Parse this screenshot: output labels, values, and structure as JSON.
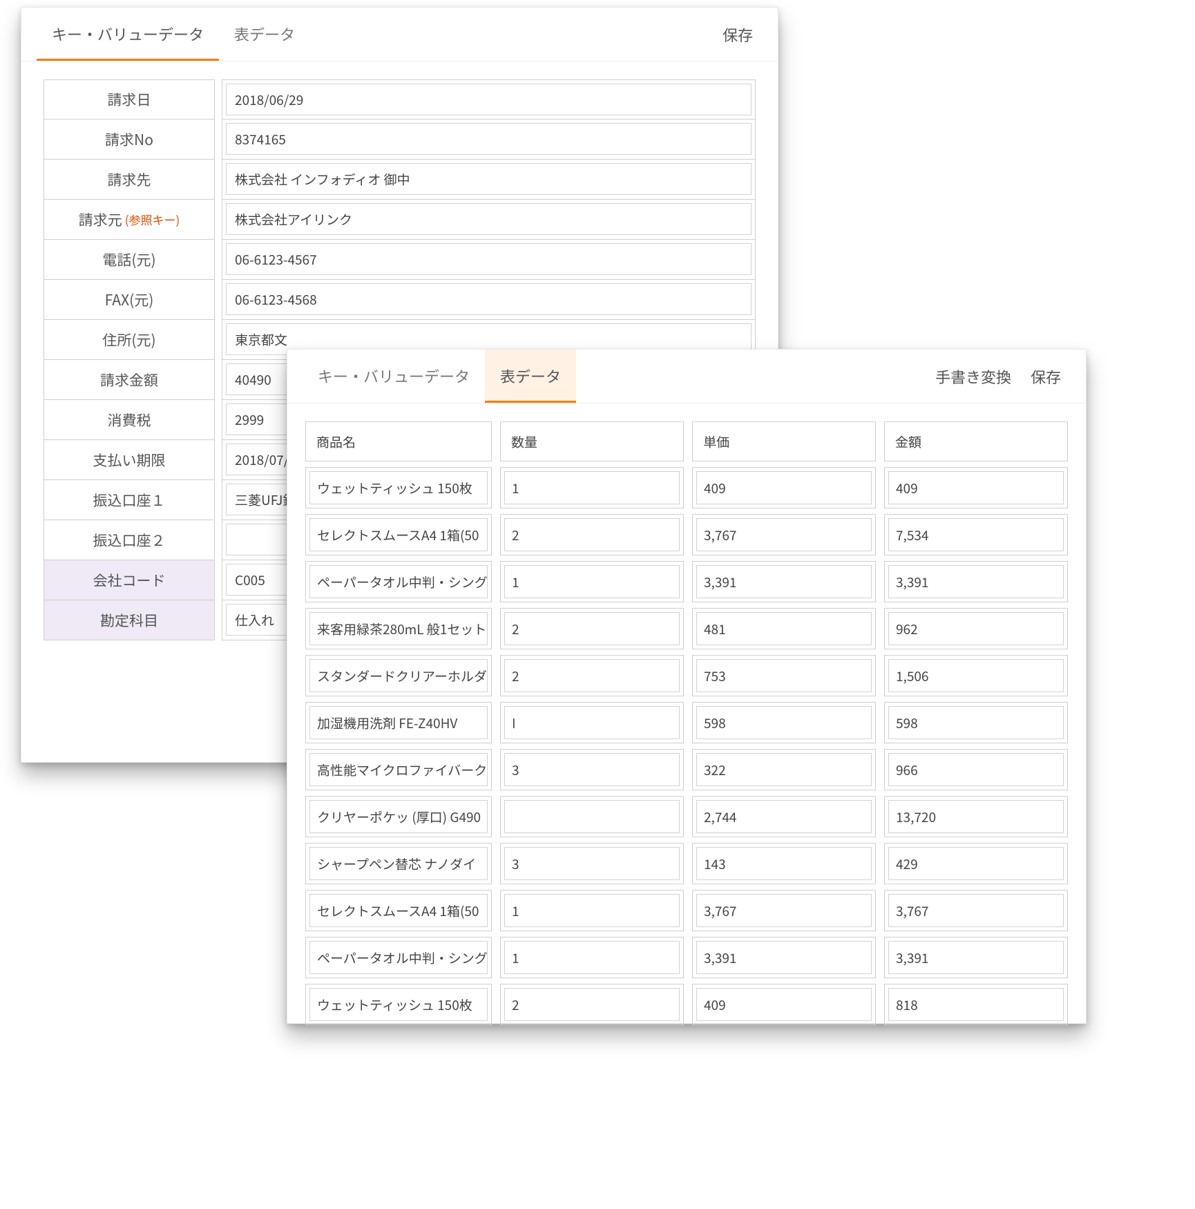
{
  "backPanel": {
    "tabs": {
      "keyValue": "キー・バリューデータ",
      "table": "表データ"
    },
    "saveLabel": "保存",
    "rows": [
      {
        "label": "請求日",
        "value": "2018/06/29"
      },
      {
        "label": "請求No",
        "value": "8374165"
      },
      {
        "label": "請求先",
        "value": "株式会社 インフォディオ 御中"
      },
      {
        "label": "請求元",
        "suffix": "(参照キー)",
        "value": "株式会社アイリンク"
      },
      {
        "label": "電話(元)",
        "value": "06-6123-4567"
      },
      {
        "label": "FAX(元)",
        "value": "06-6123-4568"
      },
      {
        "label": "住所(元)",
        "value": "東京都文"
      },
      {
        "label": "請求金額",
        "value": "40490"
      },
      {
        "label": "消費税",
        "value": "2999"
      },
      {
        "label": "支払い期限",
        "value": "2018/07/"
      },
      {
        "label": "振込口座１",
        "value": "三菱UFJ銀"
      },
      {
        "label": "振込口座２",
        "value": ""
      },
      {
        "label": "会社コード",
        "value": "C005",
        "shaded": true
      },
      {
        "label": "勘定科目",
        "value": "仕入れ",
        "shaded": true
      }
    ]
  },
  "frontPanel": {
    "tabs": {
      "keyValue": "キー・バリューデータ",
      "table": "表データ"
    },
    "handwriteLabel": "手書き変換",
    "saveLabel": "保存",
    "headers": [
      "商品名",
      "数量",
      "単価",
      "金額"
    ],
    "rows": [
      {
        "name": "ウェットティッシュ 150枚",
        "qty": "1",
        "price": "409",
        "amount": "409"
      },
      {
        "name": "セレクトスムースA4 1箱(50",
        "qty": "2",
        "price": "3,767",
        "amount": "7,534"
      },
      {
        "name": "ペーパータオル中判・シング",
        "qty": "1",
        "price": "3,391",
        "amount": "3,391"
      },
      {
        "name": "来客用緑茶280mL 般1セット",
        "qty": "2",
        "price": "481",
        "amount": "962"
      },
      {
        "name": "スタンダードクリアーホルダ",
        "qty": "2",
        "price": "753",
        "amount": "1,506"
      },
      {
        "name": "加湿機用洗剤 FE-Z40HV",
        "qty": "I",
        "price": "598",
        "amount": "598"
      },
      {
        "name": "高性能マイクロファイバーク",
        "qty": "3",
        "price": "322",
        "amount": "966"
      },
      {
        "name": "クリヤーポケッ (厚口) G490",
        "qty": "",
        "price": "2,744",
        "amount": "13,720"
      },
      {
        "name": "シャープペン替芯 ナノダイ",
        "qty": "3",
        "price": "143",
        "amount": "429"
      },
      {
        "name": "セレクトスムースA4 1箱(50",
        "qty": "1",
        "price": "3,767",
        "amount": "3,767"
      },
      {
        "name": "ペーパータオル中判・シング",
        "qty": "1",
        "price": "3,391",
        "amount": "3,391"
      },
      {
        "name": "ウェットティッシュ 150枚",
        "qty": "2",
        "price": "409",
        "amount": "818"
      }
    ]
  }
}
